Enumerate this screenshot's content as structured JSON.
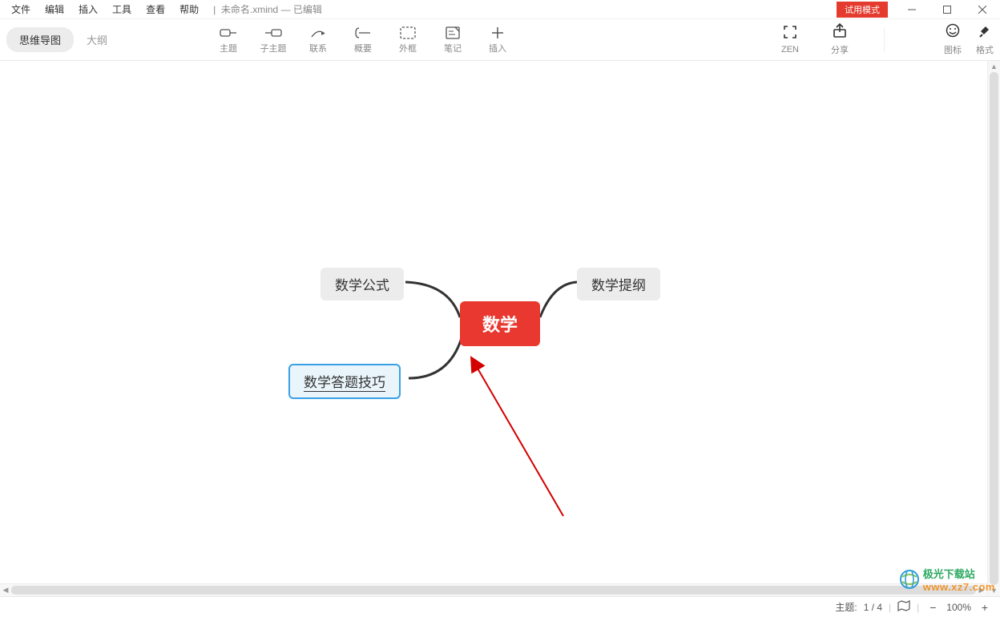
{
  "menu": {
    "file": "文件",
    "edit": "编辑",
    "insert": "插入",
    "tools": "工具",
    "view": "查看",
    "help": "帮助"
  },
  "doc": {
    "filename": "未命名.xmind",
    "status": "— 已编辑"
  },
  "titlebar": {
    "trial": "试用模式"
  },
  "viewTabs": {
    "mindmap": "思维导图",
    "outline": "大纲"
  },
  "tools": {
    "topic": "主题",
    "subtopic": "子主题",
    "relation": "联系",
    "summary": "概要",
    "boundary": "外框",
    "notes": "笔记",
    "insert": "插入",
    "zen": "ZEN",
    "share": "分享",
    "icons": "图标",
    "format": "格式"
  },
  "mindmap": {
    "central": "数学",
    "node_formula": "数学公式",
    "node_syllabus": "数学提纲",
    "node_tips": "数学答题技巧"
  },
  "status": {
    "topic_label": "主题:",
    "topic_index": "1 / 4",
    "zoom": "100%"
  },
  "watermark": {
    "name": "极光下载站",
    "url": "www.xz7.com"
  }
}
